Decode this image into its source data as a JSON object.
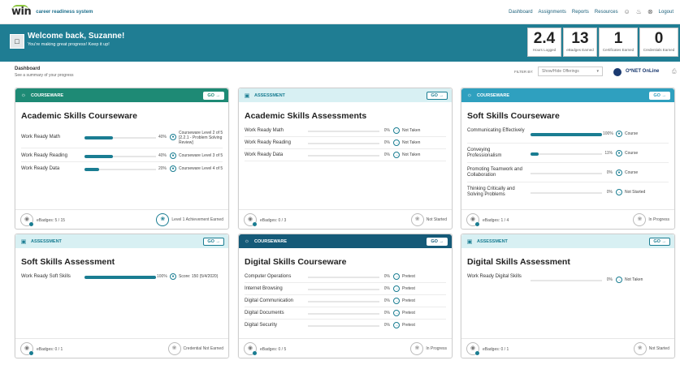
{
  "nav": {
    "logo_win": "win",
    "logo_system": "career readiness system",
    "links": [
      "Dashboard",
      "Assignments",
      "Reports",
      "Resources"
    ],
    "logout": "Logout"
  },
  "banner": {
    "welcome": "Welcome back, Suzanne!",
    "subtitle": "You're making great progress! Keep it up!",
    "stats": [
      {
        "value": "2.4",
        "label": "Hours Logged"
      },
      {
        "value": "13",
        "label": "eBadges Earned"
      },
      {
        "value": "1",
        "label": "Certificates Earned"
      },
      {
        "value": "0",
        "label": "Credentials Earned"
      }
    ]
  },
  "dashboard": {
    "title": "Dashboard",
    "subtitle": "See a summary of your progress",
    "filter_label": "FILTER BY:",
    "filter_value": "Show/Hide Offerings",
    "onet": "O*NET OnLine"
  },
  "colors": {
    "courseware_green": "#1e8a75",
    "courseware_blue": "#2fa0bf",
    "courseware_dark": "#155a78",
    "assessment_bg": "#d8f0f3",
    "bar_teal": "#1a7d92"
  },
  "cards": [
    {
      "type": "COURSEWARE",
      "go": "GO →",
      "title": "Academic Skills Courseware",
      "rows": [
        {
          "label": "Work Ready Math",
          "percent": 40,
          "pct_text": "40%",
          "status": "Courseware Level 2 of 5 [2.2.1 - Problem Solving Review]"
        },
        {
          "label": "Work Ready Reading",
          "percent": 40,
          "pct_text": "40%",
          "status": "Courseware Level 3 of 5"
        },
        {
          "label": "Work Ready Data",
          "percent": 20,
          "pct_text": "20%",
          "status": "Courseware Level 4 of 5"
        }
      ],
      "badges": "eBadges: 5 / 15",
      "foot_status": "Level 1 Achievement Earned"
    },
    {
      "type": "ASSESSMENT",
      "go": "GO →",
      "title": "Academic Skills Assessments",
      "rows": [
        {
          "label": "Work Ready Math",
          "percent": 0,
          "pct_text": "0%",
          "status": "Not Taken"
        },
        {
          "label": "Work Ready Reading",
          "percent": 0,
          "pct_text": "0%",
          "status": "Not Taken"
        },
        {
          "label": "Work Ready Data",
          "percent": 0,
          "pct_text": "0%",
          "status": "Not Taken"
        }
      ],
      "badges": "eBadges: 0 / 3",
      "foot_status": "Not Started"
    },
    {
      "type": "COURSEWARE",
      "go": "GO →",
      "title": "Soft Skills Courseware",
      "rows": [
        {
          "label": "Communicating Effectively",
          "percent": 100,
          "pct_text": "100%",
          "status": "Course"
        },
        {
          "label": "Conveying Professionalism",
          "percent": 11,
          "pct_text": "11%",
          "status": "Course"
        },
        {
          "label": "Promoting Teamwork and Collaboration",
          "percent": 0,
          "pct_text": "0%",
          "status": "Course"
        },
        {
          "label": "Thinking Critically and Solving Problems",
          "percent": 0,
          "pct_text": "0%",
          "status": "Not Started"
        }
      ],
      "badges": "eBadges: 1 / 4",
      "foot_status": "In Progress"
    },
    {
      "type": "ASSESSMENT",
      "go": "GO →",
      "title": "Soft Skills Assessment",
      "rows": [
        {
          "label": "Work Ready Soft Skills",
          "percent": 100,
          "pct_text": "100%",
          "status": "Score: 150 (5/4/2020)"
        }
      ],
      "badges": "eBadges: 0 / 1",
      "foot_status": "Credential Not Earned"
    },
    {
      "type": "COURSEWARE",
      "go": "GO →",
      "title": "Digital Skills Courseware",
      "rows": [
        {
          "label": "Computer Operations",
          "percent": 0,
          "pct_text": "0%",
          "status": "Pretest"
        },
        {
          "label": "Internet Browsing",
          "percent": 0,
          "pct_text": "0%",
          "status": "Pretest"
        },
        {
          "label": "Digital Communication",
          "percent": 0,
          "pct_text": "0%",
          "status": "Pretest"
        },
        {
          "label": "Digital Documents",
          "percent": 0,
          "pct_text": "0%",
          "status": "Pretest"
        },
        {
          "label": "Digital Security",
          "percent": 0,
          "pct_text": "0%",
          "status": "Pretest"
        }
      ],
      "badges": "eBadges: 0 / 5",
      "foot_status": "In Progress"
    },
    {
      "type": "ASSESSMENT",
      "go": "GO →",
      "title": "Digital Skills Assessment",
      "rows": [
        {
          "label": "Work Ready Digital Skills",
          "percent": 0,
          "pct_text": "0%",
          "status": "Not Taken"
        }
      ],
      "badges": "eBadges: 0 / 1",
      "foot_status": "Not Started"
    }
  ]
}
